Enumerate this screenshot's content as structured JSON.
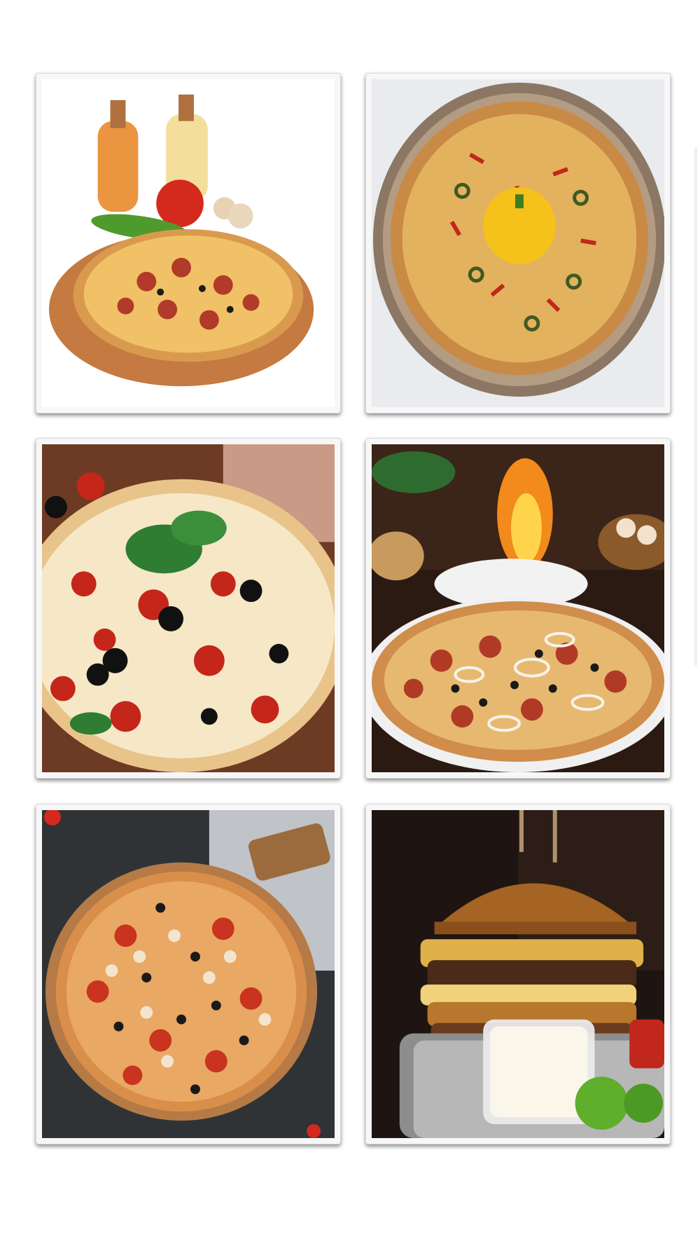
{
  "gallery": {
    "items": [
      {
        "icon": "pizza-with-oil-bottles-photo"
      },
      {
        "icon": "pepper-pizza-on-metal-tray-photo"
      },
      {
        "icon": "basil-olive-pizza-photo"
      },
      {
        "icon": "onion-olive-pizza-by-fire-photo"
      },
      {
        "icon": "mushroom-pizza-on-board-photo"
      },
      {
        "icon": "burger-with-sauce-photo"
      }
    ]
  },
  "colors": {
    "background": "#ffffff",
    "card_frame": "#f7f7f7",
    "crust": "#d99a4f",
    "sauce": "#c0392b",
    "cheese": "#f4d07a",
    "pepperoni": "#b23a2a",
    "olive": "#1c1c1c",
    "basil": "#2e7d32",
    "wood": "#c47a40"
  }
}
